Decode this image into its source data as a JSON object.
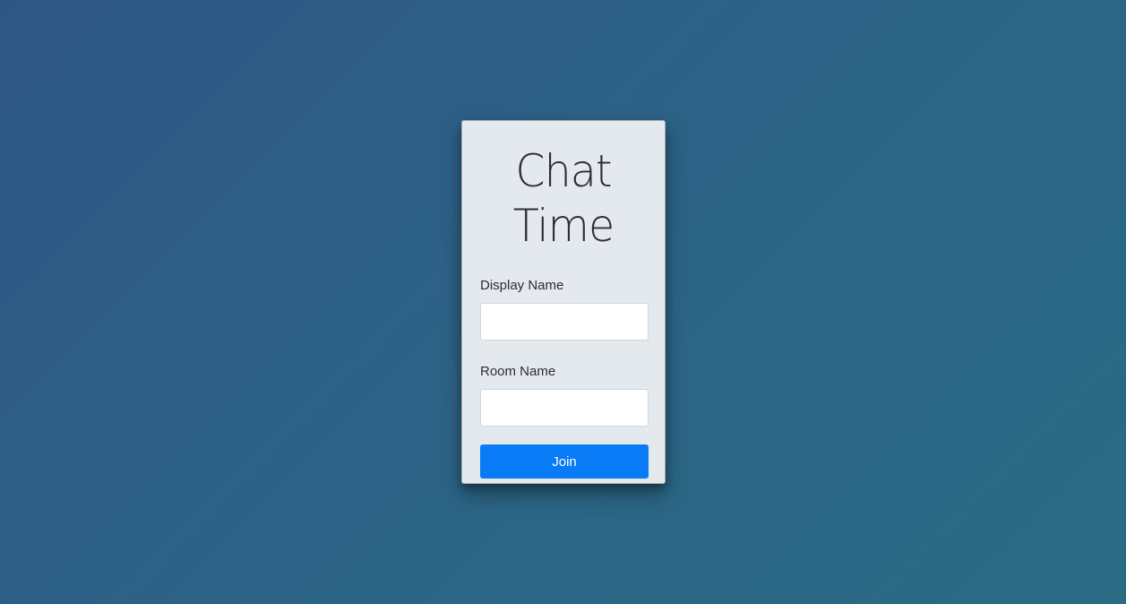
{
  "app": {
    "title_line1": "Chat",
    "title_line2": "Time"
  },
  "form": {
    "display_name_label": "Display Name",
    "display_name_value": "",
    "room_name_label": "Room Name",
    "room_name_value": "",
    "join_label": "Join"
  },
  "colors": {
    "background_start": "#2f5785",
    "background_end": "#2a6b84",
    "card": "#e4e9ee",
    "primary_button": "#0a7bf6",
    "text": "#2b2f33"
  }
}
